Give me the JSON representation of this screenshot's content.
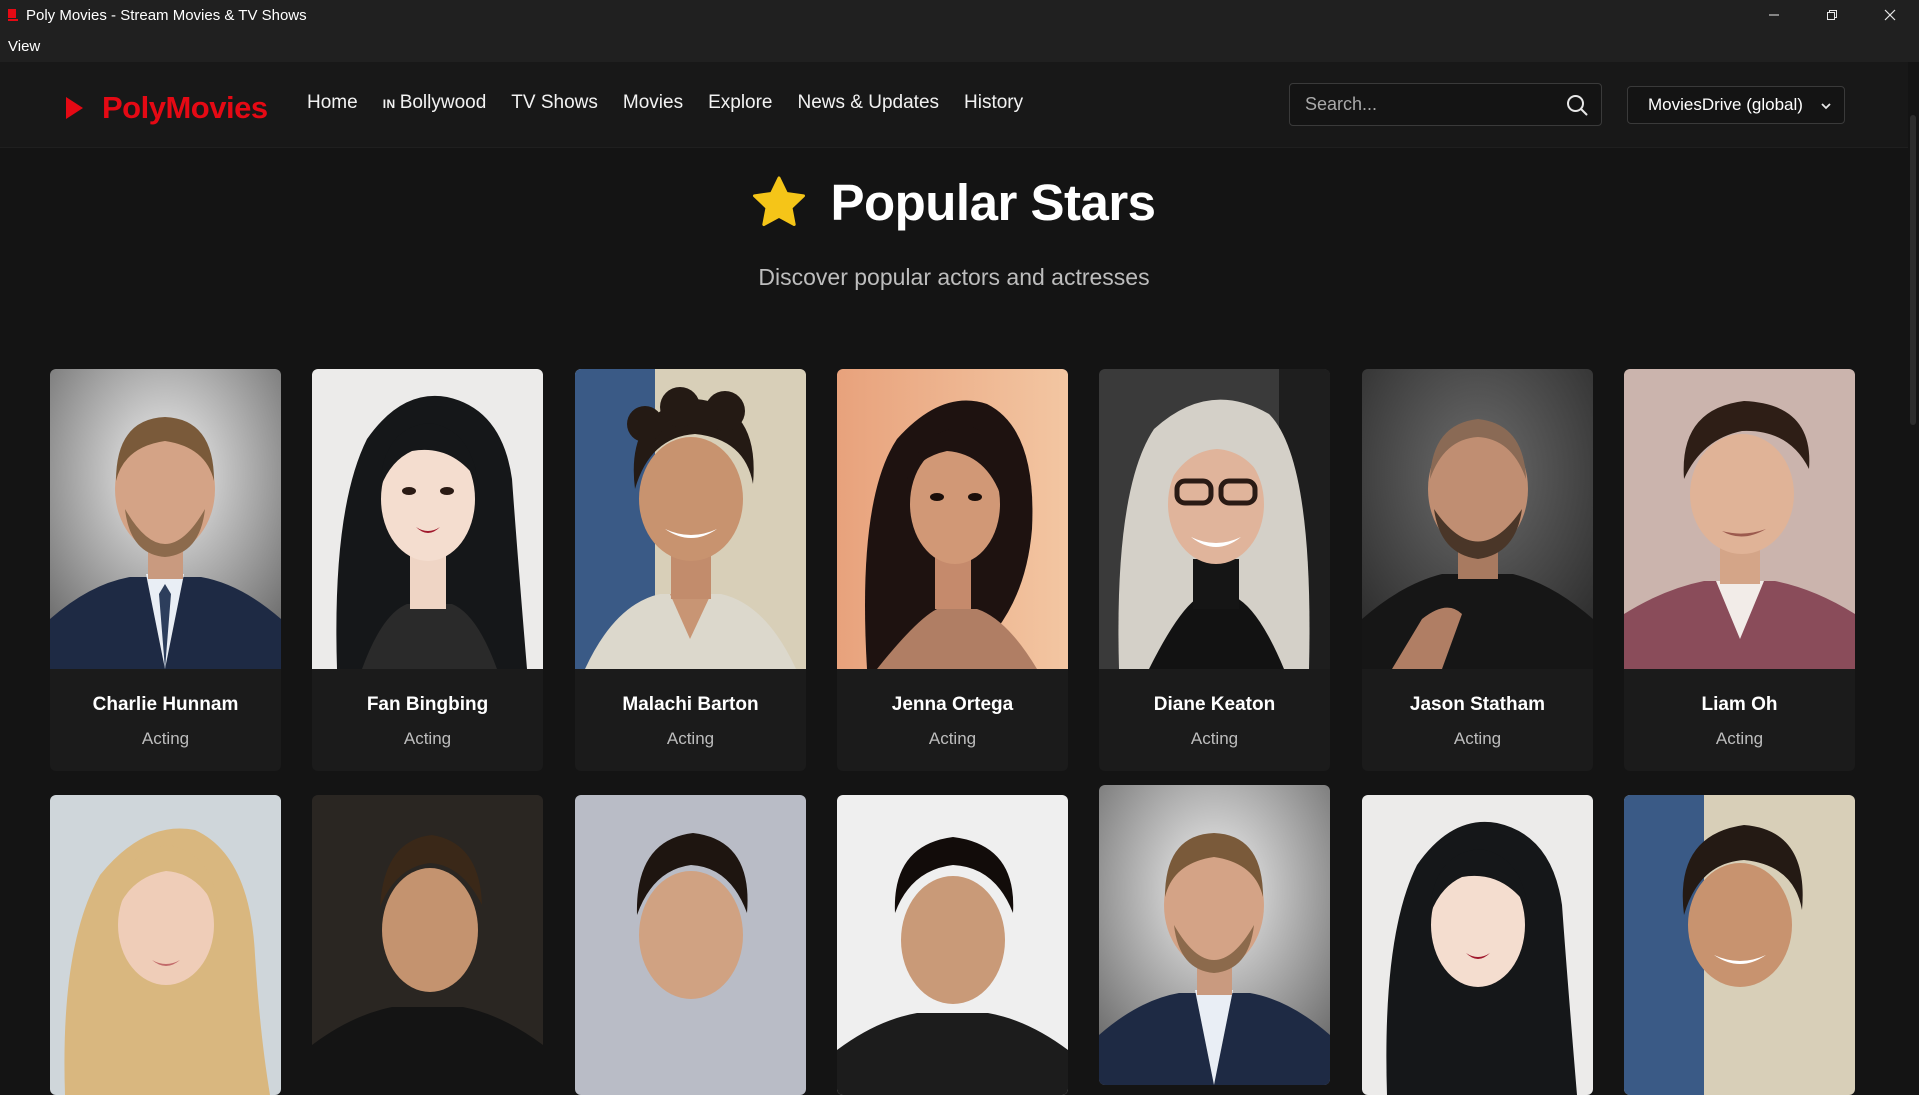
{
  "window": {
    "title": "Poly Movies - Stream Movies & TV Shows",
    "controls": [
      "minimize-icon",
      "restore-icon",
      "close-icon"
    ]
  },
  "menubar": {
    "items": [
      "View"
    ]
  },
  "header": {
    "logo_text": "PolyMovies",
    "nav": [
      {
        "label": "Home"
      },
      {
        "flag": "IN",
        "label": "Bollywood"
      },
      {
        "label": "TV Shows"
      },
      {
        "label": "Movies"
      },
      {
        "label": "Explore"
      },
      {
        "label": "News & Updates"
      },
      {
        "label": "History"
      }
    ],
    "search": {
      "placeholder": "Search...",
      "value": ""
    },
    "source_select": {
      "selected": "MoviesDrive (global)"
    }
  },
  "page": {
    "title": "Popular Stars",
    "subtitle": "Discover popular actors and actresses"
  },
  "colors": {
    "accent": "#e50914",
    "star": "#f5c518",
    "background": "#141414",
    "card": "#1b1b1b"
  },
  "stars": [
    {
      "name": "Charlie Hunnam",
      "department": "Acting"
    },
    {
      "name": "Fan Bingbing",
      "department": "Acting"
    },
    {
      "name": "Malachi Barton",
      "department": "Acting"
    },
    {
      "name": "Jenna Ortega",
      "department": "Acting"
    },
    {
      "name": "Diane Keaton",
      "department": "Acting"
    },
    {
      "name": "Jason Statham",
      "department": "Acting"
    },
    {
      "name": "Liam Oh",
      "department": "Acting"
    }
  ],
  "stars_row2_photos": 7
}
